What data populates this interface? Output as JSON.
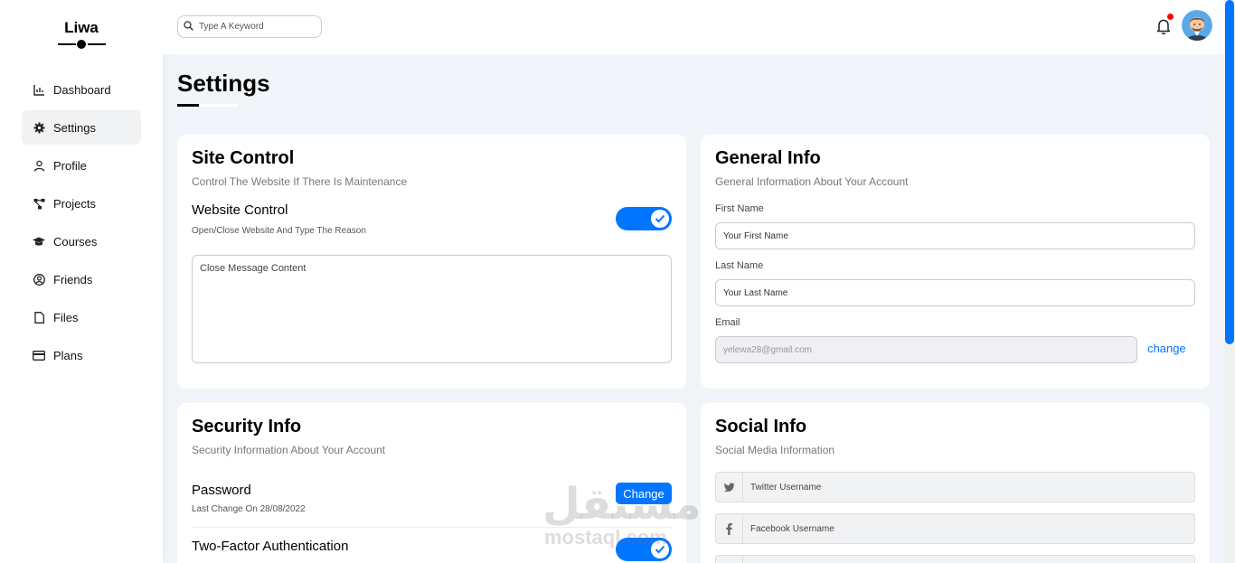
{
  "brand": {
    "name": "Liwa"
  },
  "sidebar": {
    "items": [
      {
        "label": "Dashboard",
        "icon": "chart-icon"
      },
      {
        "label": "Settings",
        "icon": "gear-icon",
        "active": true
      },
      {
        "label": "Profile",
        "icon": "user-icon"
      },
      {
        "label": "Projects",
        "icon": "diagram-icon"
      },
      {
        "label": "Courses",
        "icon": "graduation-cap-icon"
      },
      {
        "label": "Friends",
        "icon": "user-circle-icon"
      },
      {
        "label": "Files",
        "icon": "file-icon"
      },
      {
        "label": "Plans",
        "icon": "credit-card-icon"
      }
    ]
  },
  "header": {
    "search_placeholder": "Type A Keyword",
    "notification_icon": "bell-icon",
    "has_unread": true
  },
  "page": {
    "title": "Settings"
  },
  "site_control": {
    "title": "Site Control",
    "subtitle": "Control The Website If There Is Maintenance",
    "website_control_label": "Website Control",
    "website_control_sub": "Open/Close Website And Type The Reason",
    "website_control_on": true,
    "message_placeholder": "Close Message Content"
  },
  "general_info": {
    "title": "General Info",
    "subtitle": "General Information About Your Account",
    "first_name_label": "First Name",
    "first_name_placeholder": "Your First Name",
    "last_name_label": "Last Name",
    "last_name_placeholder": "Your Last Name",
    "email_label": "Email",
    "email_value": "yelewa28@gmail.com",
    "change_link": "change"
  },
  "security_info": {
    "title": "Security Info",
    "subtitle": "Security Information About Your Account",
    "password_label": "Password",
    "password_sub": "Last Change On 28/08/2022",
    "change_button": "Change",
    "two_factor_label": "Two-Factor Authentication",
    "two_factor_on": true
  },
  "social_info": {
    "title": "Social Info",
    "subtitle": "Social Media Information",
    "twitter_placeholder": "Twitter Username",
    "facebook_placeholder": "Facebook Username"
  },
  "colors": {
    "accent": "#0075ff",
    "background": "#f1f5f9",
    "notification": "#ff0000"
  },
  "watermark": {
    "arabic": "مستقل",
    "latin": "mostaql.com"
  }
}
